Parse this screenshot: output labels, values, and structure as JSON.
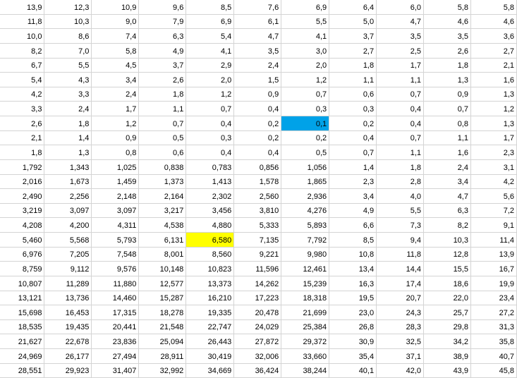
{
  "sheet": {
    "rows": [
      [
        "13,9",
        "12,3",
        "10,9",
        "9,6",
        "8,5",
        "7,6",
        "6,9",
        "6,4",
        "6,0",
        "5,8",
        "5,8"
      ],
      [
        "11,8",
        "10,3",
        "9,0",
        "7,9",
        "6,9",
        "6,1",
        "5,5",
        "5,0",
        "4,7",
        "4,6",
        "4,6"
      ],
      [
        "10,0",
        "8,6",
        "7,4",
        "6,3",
        "5,4",
        "4,7",
        "4,1",
        "3,7",
        "3,5",
        "3,5",
        "3,6"
      ],
      [
        "8,2",
        "7,0",
        "5,8",
        "4,9",
        "4,1",
        "3,5",
        "3,0",
        "2,7",
        "2,5",
        "2,6",
        "2,7"
      ],
      [
        "6,7",
        "5,5",
        "4,5",
        "3,7",
        "2,9",
        "2,4",
        "2,0",
        "1,8",
        "1,7",
        "1,8",
        "2,1"
      ],
      [
        "5,4",
        "4,3",
        "3,4",
        "2,6",
        "2,0",
        "1,5",
        "1,2",
        "1,1",
        "1,1",
        "1,3",
        "1,6"
      ],
      [
        "4,2",
        "3,3",
        "2,4",
        "1,8",
        "1,2",
        "0,9",
        "0,7",
        "0,6",
        "0,7",
        "0,9",
        "1,3"
      ],
      [
        "3,3",
        "2,4",
        "1,7",
        "1,1",
        "0,7",
        "0,4",
        "0,3",
        "0,3",
        "0,4",
        "0,7",
        "1,2"
      ],
      [
        "2,6",
        "1,8",
        "1,2",
        "0,7",
        "0,4",
        "0,2",
        "0,1",
        "0,2",
        "0,4",
        "0,8",
        "1,3"
      ],
      [
        "2,1",
        "1,4",
        "0,9",
        "0,5",
        "0,3",
        "0,2",
        "0,2",
        "0,4",
        "0,7",
        "1,1",
        "1,7"
      ],
      [
        "1,8",
        "1,3",
        "0,8",
        "0,6",
        "0,4",
        "0,4",
        "0,5",
        "0,7",
        "1,1",
        "1,6",
        "2,3"
      ],
      [
        "1,792",
        "1,343",
        "1,025",
        "0,838",
        "0,783",
        "0,856",
        "1,056",
        "1,4",
        "1,8",
        "2,4",
        "3,1"
      ],
      [
        "2,016",
        "1,673",
        "1,459",
        "1,373",
        "1,413",
        "1,578",
        "1,865",
        "2,3",
        "2,8",
        "3,4",
        "4,2"
      ],
      [
        "2,490",
        "2,256",
        "2,148",
        "2,164",
        "2,302",
        "2,560",
        "2,936",
        "3,4",
        "4,0",
        "4,7",
        "5,6"
      ],
      [
        "3,219",
        "3,097",
        "3,097",
        "3,217",
        "3,456",
        "3,810",
        "4,276",
        "4,9",
        "5,5",
        "6,3",
        "7,2"
      ],
      [
        "4,208",
        "4,200",
        "4,311",
        "4,538",
        "4,880",
        "5,333",
        "5,893",
        "6,6",
        "7,3",
        "8,2",
        "9,1"
      ],
      [
        "5,460",
        "5,568",
        "5,793",
        "6,131",
        "6,580",
        "7,135",
        "7,792",
        "8,5",
        "9,4",
        "10,3",
        "11,4"
      ],
      [
        "6,976",
        "7,205",
        "7,548",
        "8,001",
        "8,560",
        "9,221",
        "9,980",
        "10,8",
        "11,8",
        "12,8",
        "13,9"
      ],
      [
        "8,759",
        "9,112",
        "9,576",
        "10,148",
        "10,823",
        "11,596",
        "12,461",
        "13,4",
        "14,4",
        "15,5",
        "16,7"
      ],
      [
        "10,807",
        "11,289",
        "11,880",
        "12,577",
        "13,373",
        "14,262",
        "15,239",
        "16,3",
        "17,4",
        "18,6",
        "19,9"
      ],
      [
        "13,121",
        "13,736",
        "14,460",
        "15,287",
        "16,210",
        "17,223",
        "18,318",
        "19,5",
        "20,7",
        "22,0",
        "23,4"
      ],
      [
        "15,698",
        "16,453",
        "17,315",
        "18,278",
        "19,335",
        "20,478",
        "21,699",
        "23,0",
        "24,3",
        "25,7",
        "27,2"
      ],
      [
        "18,535",
        "19,435",
        "20,441",
        "21,548",
        "22,747",
        "24,029",
        "25,384",
        "26,8",
        "28,3",
        "29,8",
        "31,3"
      ],
      [
        "21,627",
        "22,678",
        "23,836",
        "25,094",
        "26,443",
        "27,872",
        "29,372",
        "30,9",
        "32,5",
        "34,2",
        "35,8"
      ],
      [
        "24,969",
        "26,177",
        "27,494",
        "28,911",
        "30,419",
        "32,006",
        "33,660",
        "35,4",
        "37,1",
        "38,9",
        "40,7"
      ],
      [
        "28,551",
        "29,923",
        "31,407",
        "32,992",
        "34,669",
        "36,424",
        "38,244",
        "40,1",
        "42,0",
        "43,9",
        "45,8"
      ]
    ],
    "highlights": [
      {
        "row": 8,
        "col": 6,
        "color": "#00a2e8"
      },
      {
        "row": 16,
        "col": 4,
        "color": "#ffff00"
      }
    ],
    "gridline_color": "#d4d4d4"
  }
}
